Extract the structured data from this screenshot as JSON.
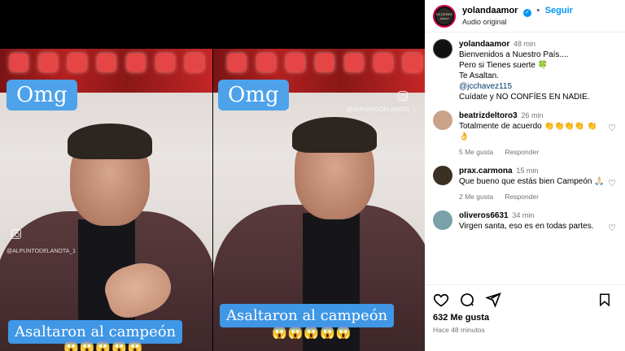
{
  "video": {
    "left": {
      "overlay_title": "Omg",
      "caption": "Asaltaron al campeón",
      "emojis": "😱😱😱😱😱",
      "watermark": "@ALPUNTODELANOTA_1"
    },
    "right": {
      "overlay_title": "Omg",
      "caption": "Asaltaron al campeón",
      "emojis": "😱😱😱😱😱",
      "watermark": "@ALPUNTODELANOTA_1"
    }
  },
  "header": {
    "username": "yolandaamor",
    "verified_icon": "verified-badge-icon",
    "separator": "•",
    "follow_label": "Seguir",
    "audio_label": "Audio original",
    "avatar_text": "MUJERES Amor"
  },
  "caption_post": {
    "username": "yolandaamor",
    "time": "48 min",
    "lines": [
      "Bienvenidos a Nuestro País....",
      "Pero si Tienes suerte 🍀",
      "Te Asaltan.",
      "@jcchavez115",
      "Cuídate y NO CONFÍES EN NADIE."
    ]
  },
  "comments": [
    {
      "username": "beatrizdeltoro3",
      "time": "26 min",
      "text": "Totalmente de acuerdo 👏👏👏👏 👏👌",
      "likes": "5 Me gusta",
      "reply": "Responder",
      "avatar_color": "#c9a28a"
    },
    {
      "username": "prax.carmona",
      "time": "15 min",
      "text": "Que bueno que estás bien Campeón 🙏🏻",
      "likes": "2 Me gusta",
      "reply": "Responder",
      "avatar_color": "#3b3024"
    },
    {
      "username": "oliveros6631",
      "time": "34 min",
      "text": "Virgen santa, eso es en todas partes.",
      "avatar_color": "#7aa0a8"
    }
  ],
  "actions": {
    "like_icon": "heart-icon",
    "comment_icon": "comment-icon",
    "share_icon": "send-icon",
    "save_icon": "bookmark-icon",
    "likes_count": "632 Me gusta",
    "time_ago": "Hace 48 minutos"
  },
  "colors": {
    "accent": "#0095f6",
    "overlay_blue": "#4da2ea"
  }
}
